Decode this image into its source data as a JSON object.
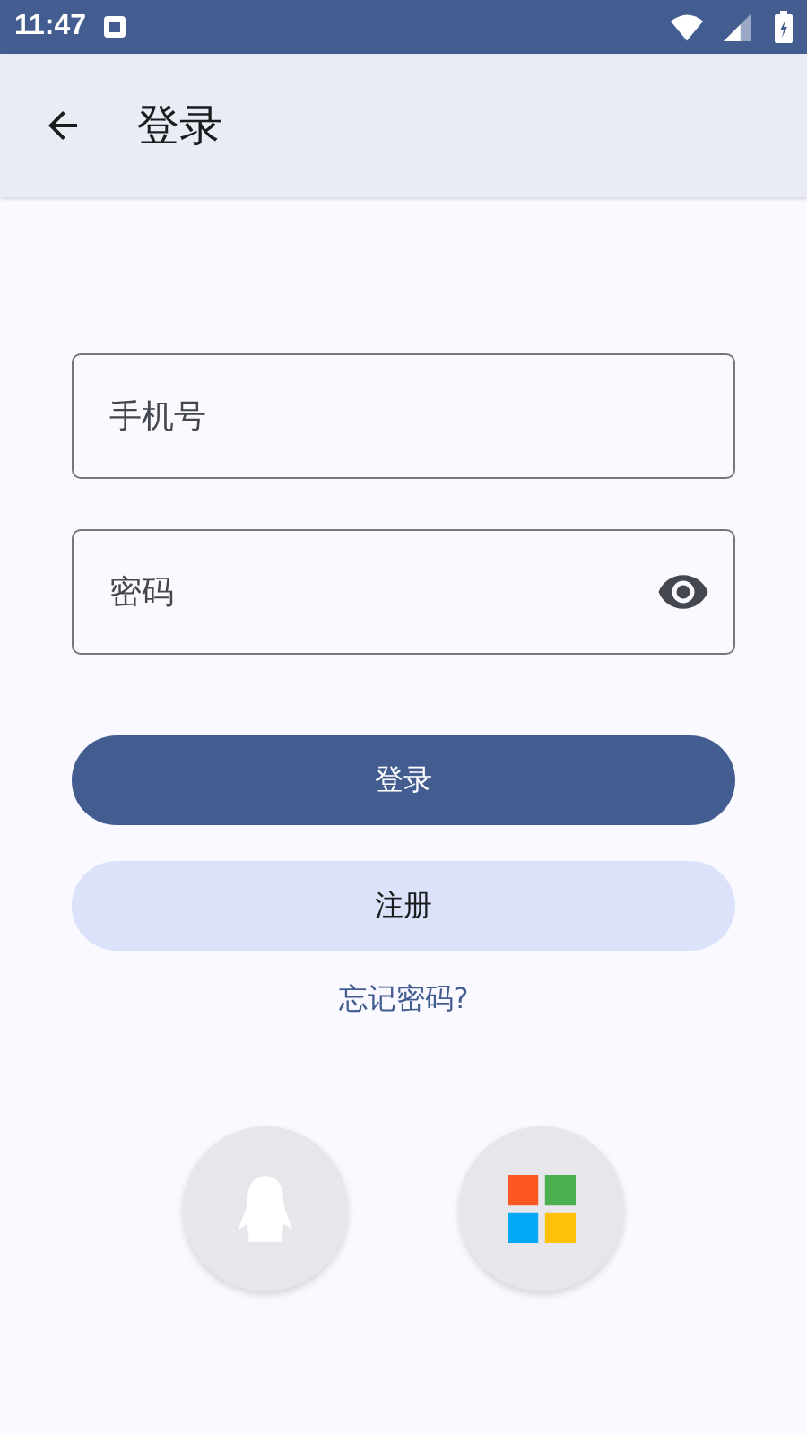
{
  "status_bar": {
    "time": "11:47"
  },
  "app_bar": {
    "title": "登录"
  },
  "fields": [
    {
      "kind": "phone",
      "placeholder": "手机号"
    },
    {
      "kind": "password",
      "placeholder": "密码"
    }
  ],
  "buttons": [
    {
      "kind": "primary",
      "label": "登录"
    },
    {
      "kind": "secondary",
      "label": "注册"
    }
  ],
  "forgot_link": "忘记密码?",
  "social_logins": [
    {
      "kind": "penguin"
    },
    {
      "kind": "windows"
    }
  ]
}
